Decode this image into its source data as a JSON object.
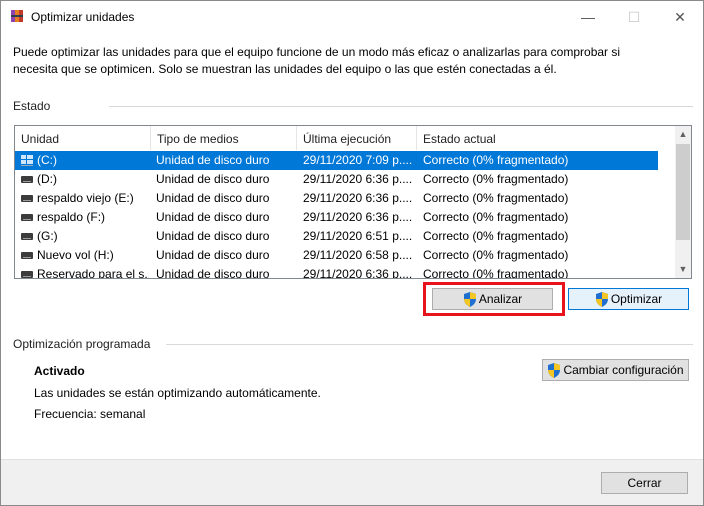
{
  "window": {
    "title": "Optimizar unidades",
    "minimize_glyph": "—",
    "maximize_glyph": "☐",
    "close_glyph": "✕"
  },
  "description": "Puede optimizar las unidades para que el equipo funcione de un modo más eficaz o analizarlas para comprobar si necesita que se optimicen. Solo se muestran las unidades del equipo o las que estén conectadas a él.",
  "estado": {
    "label": "Estado",
    "columns": [
      "Unidad",
      "Tipo de medios",
      "Última ejecución",
      "Estado actual"
    ],
    "drives": [
      {
        "unidad": "(C:)",
        "tipo": "Unidad de disco duro",
        "ultima": "29/11/2020 7:09 p....",
        "estado": "Correcto (0% fragmentado)",
        "icon": "windows-drive-icon",
        "selected": true
      },
      {
        "unidad": "(D:)",
        "tipo": "Unidad de disco duro",
        "ultima": "29/11/2020 6:36 p....",
        "estado": "Correcto (0% fragmentado)",
        "icon": "hard-drive-icon",
        "selected": false
      },
      {
        "unidad": "respaldo viejo (E:)",
        "tipo": "Unidad de disco duro",
        "ultima": "29/11/2020 6:36 p....",
        "estado": "Correcto (0% fragmentado)",
        "icon": "hard-drive-icon",
        "selected": false
      },
      {
        "unidad": "respaldo  (F:)",
        "tipo": "Unidad de disco duro",
        "ultima": "29/11/2020 6:36 p....",
        "estado": "Correcto (0% fragmentado)",
        "icon": "hard-drive-icon",
        "selected": false
      },
      {
        "unidad": "(G:)",
        "tipo": "Unidad de disco duro",
        "ultima": "29/11/2020 6:51 p....",
        "estado": "Correcto (0% fragmentado)",
        "icon": "hard-drive-icon",
        "selected": false
      },
      {
        "unidad": "Nuevo vol (H:)",
        "tipo": "Unidad de disco duro",
        "ultima": "29/11/2020 6:58 p....",
        "estado": "Correcto (0% fragmentado)",
        "icon": "hard-drive-icon",
        "selected": false
      },
      {
        "unidad": "Reservado para el s...",
        "tipo": "Unidad de disco duro",
        "ultima": "29/11/2020 6:36 p....",
        "estado": "Correcto (0% fragmentado)",
        "icon": "hard-drive-icon",
        "selected": false
      }
    ],
    "analizar_label": "Analizar",
    "optimizar_label": "Optimizar"
  },
  "programada": {
    "label": "Optimización programada",
    "status": "Activado",
    "description": "Las unidades se están optimizando automáticamente.",
    "frecuencia": "Frecuencia: semanal",
    "cambiar_label": "Cambiar configuración"
  },
  "footer": {
    "cerrar_label": "Cerrar"
  },
  "colors": {
    "selection": "#0078d7",
    "highlight_border": "#e8141b"
  }
}
